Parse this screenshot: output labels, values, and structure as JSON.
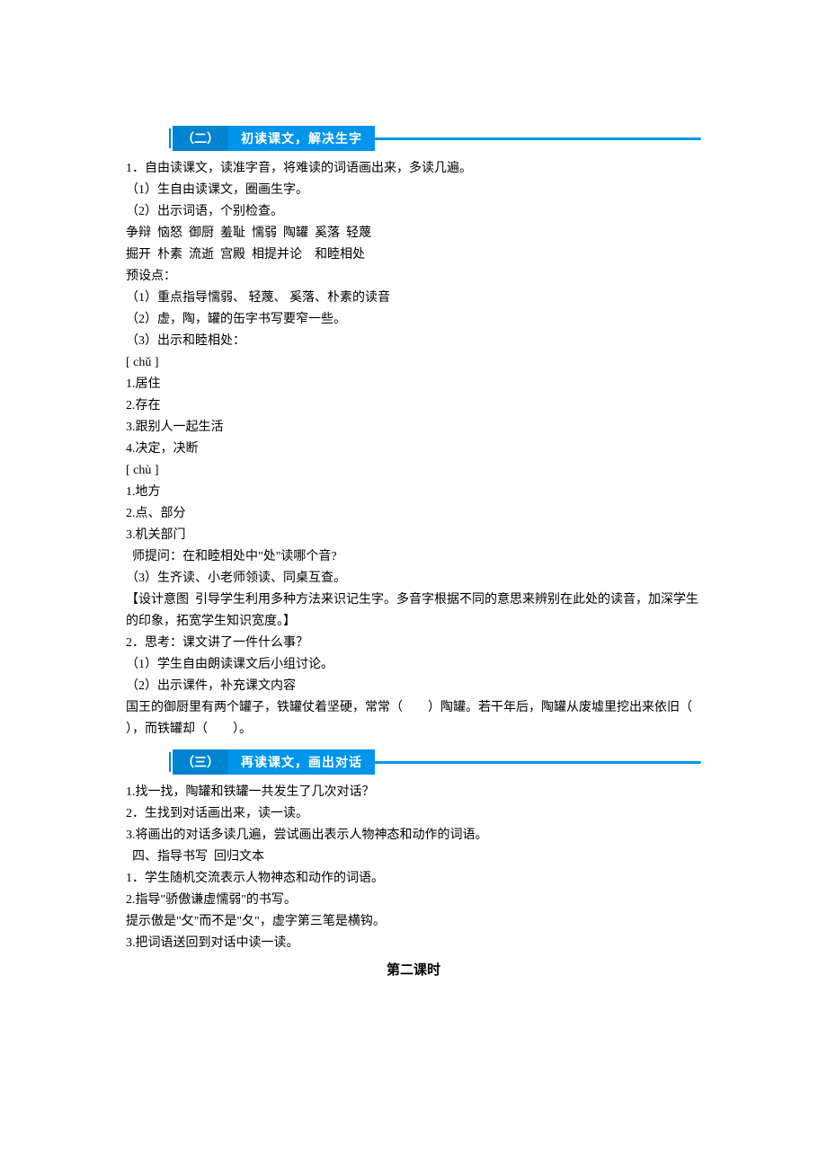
{
  "section2": {
    "tab": "（二）",
    "title": "初读课文，解决生字",
    "lines": [
      "1．自由读课文，读准字音，将难读的词语画出来，多读几遍。",
      "（1）生自由读课文，圈画生字。",
      "（2）出示词语，个别检查。",
      "争辩  恼怒  御厨  羞耻  懦弱  陶罐  奚落  轻蔑",
      "掘开  朴素  流逝  宫殿  相提并论    和睦相处",
      "预设点：",
      "（1）重点指导懦弱、 轻蔑、 奚落、朴素的读音",
      "（2）虚，陶，罐的缶字书写要窄一些。",
      "（3）出示和睦相处：",
      "[ chǔ ]",
      "1.居住",
      "2.存在",
      "3.跟别人一起生活",
      "4.决定，决断",
      "[ chù ]",
      "1.地方",
      "2.点、部分",
      "3.机关部门",
      "  师提问：在和睦相处中\"处\"读哪个音?",
      "（3）生齐读、小老师领读、同桌互查。",
      "【设计意图  引导学生利用多种方法来识记生字。多音字根据不同的意思来辨别在此处的读音，加深学生的印象，拓宽学生知识宽度。】",
      "2．思考：课文讲了一件什么事？",
      "（1）学生自由朗读课文后小组讨论。",
      "（2）出示课件，补充课文内容",
      "国王的御厨里有两个罐子，铁罐仗着坚硬，常常（        ）陶罐。若干年后，陶罐从废墟里挖出来依旧（      ），而铁罐却（        ）。"
    ]
  },
  "section3": {
    "tab": "（三）",
    "title": "再读课文，画出对话",
    "lines": [
      "1.找一找，陶罐和铁罐一共发生了几次对话？",
      "2．生找到对话画出来，读一读。",
      "3.将画出的对话多读几遍，尝试画出表示人物神态和动作的词语。",
      "  四、指导书写  回归文本",
      "1．学生随机交流表示人物神态和动作的词语。",
      "2.指导\"骄傲谦虚懦弱\"的书写。",
      "提示傲是\"攵\"而不是\"夂\"，虚字第三笔是横钩。",
      "3.把词语送回到对话中读一读。"
    ]
  },
  "next_heading": "第二课时"
}
